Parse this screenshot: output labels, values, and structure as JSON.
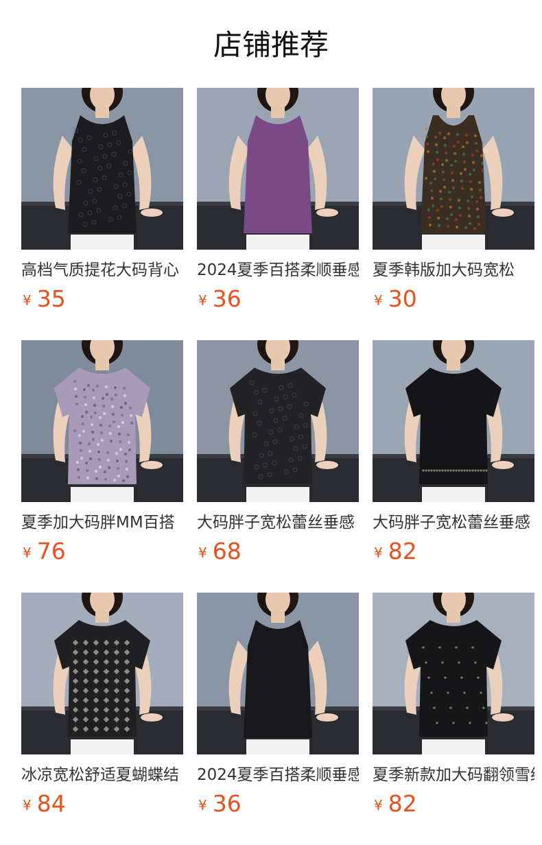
{
  "section": {
    "title": "店铺推荐"
  },
  "currency_symbol": "¥",
  "products": [
    {
      "name": "高档气质提花大码背心",
      "price": "35",
      "top_color": "#1c1c1e",
      "pattern": "jacquard",
      "sleeve": "none",
      "bg_color": "#8a96a6"
    },
    {
      "name": "2024夏季百搭柔顺垂感",
      "price": "36",
      "top_color": "#7a4a86",
      "pattern": "plain",
      "sleeve": "none",
      "bg_color": "#9aa4b2"
    },
    {
      "name": "夏季韩版加大码宽松",
      "price": "30",
      "top_color": "#3a2d22",
      "pattern": "floral-dots",
      "sleeve": "strap",
      "bg_color": "#98a3b3"
    },
    {
      "name": "夏季加大码胖MM百搭",
      "price": "76",
      "top_color": "#a89ab8",
      "pattern": "floral-light",
      "sleeve": "short",
      "bg_color": "#7f8a9b"
    },
    {
      "name": "大码胖子宽松蕾丝垂感",
      "price": "68",
      "top_color": "#232326",
      "pattern": "lace",
      "sleeve": "short",
      "bg_color": "#8b95a4"
    },
    {
      "name": "大码胖子宽松蕾丝垂感",
      "price": "82",
      "top_color": "#151517",
      "pattern": "studs",
      "sleeve": "short",
      "bg_color": "#9ba6b4"
    },
    {
      "name": "冰凉宽松舒适夏蝴蝶结",
      "price": "84",
      "top_color": "#202022",
      "pattern": "geo",
      "sleeve": "short",
      "bg_color": "#a3adbb"
    },
    {
      "name": "2024夏季百搭柔顺垂感",
      "price": "36",
      "top_color": "#18181a",
      "pattern": "plain",
      "sleeve": "none",
      "bg_color": "#8a95a5"
    },
    {
      "name": "夏季新款加大码翻领雪纺",
      "price": "82",
      "top_color": "#161618",
      "pattern": "swiss-dot",
      "sleeve": "short",
      "bg_color": "#a7b1be"
    }
  ]
}
